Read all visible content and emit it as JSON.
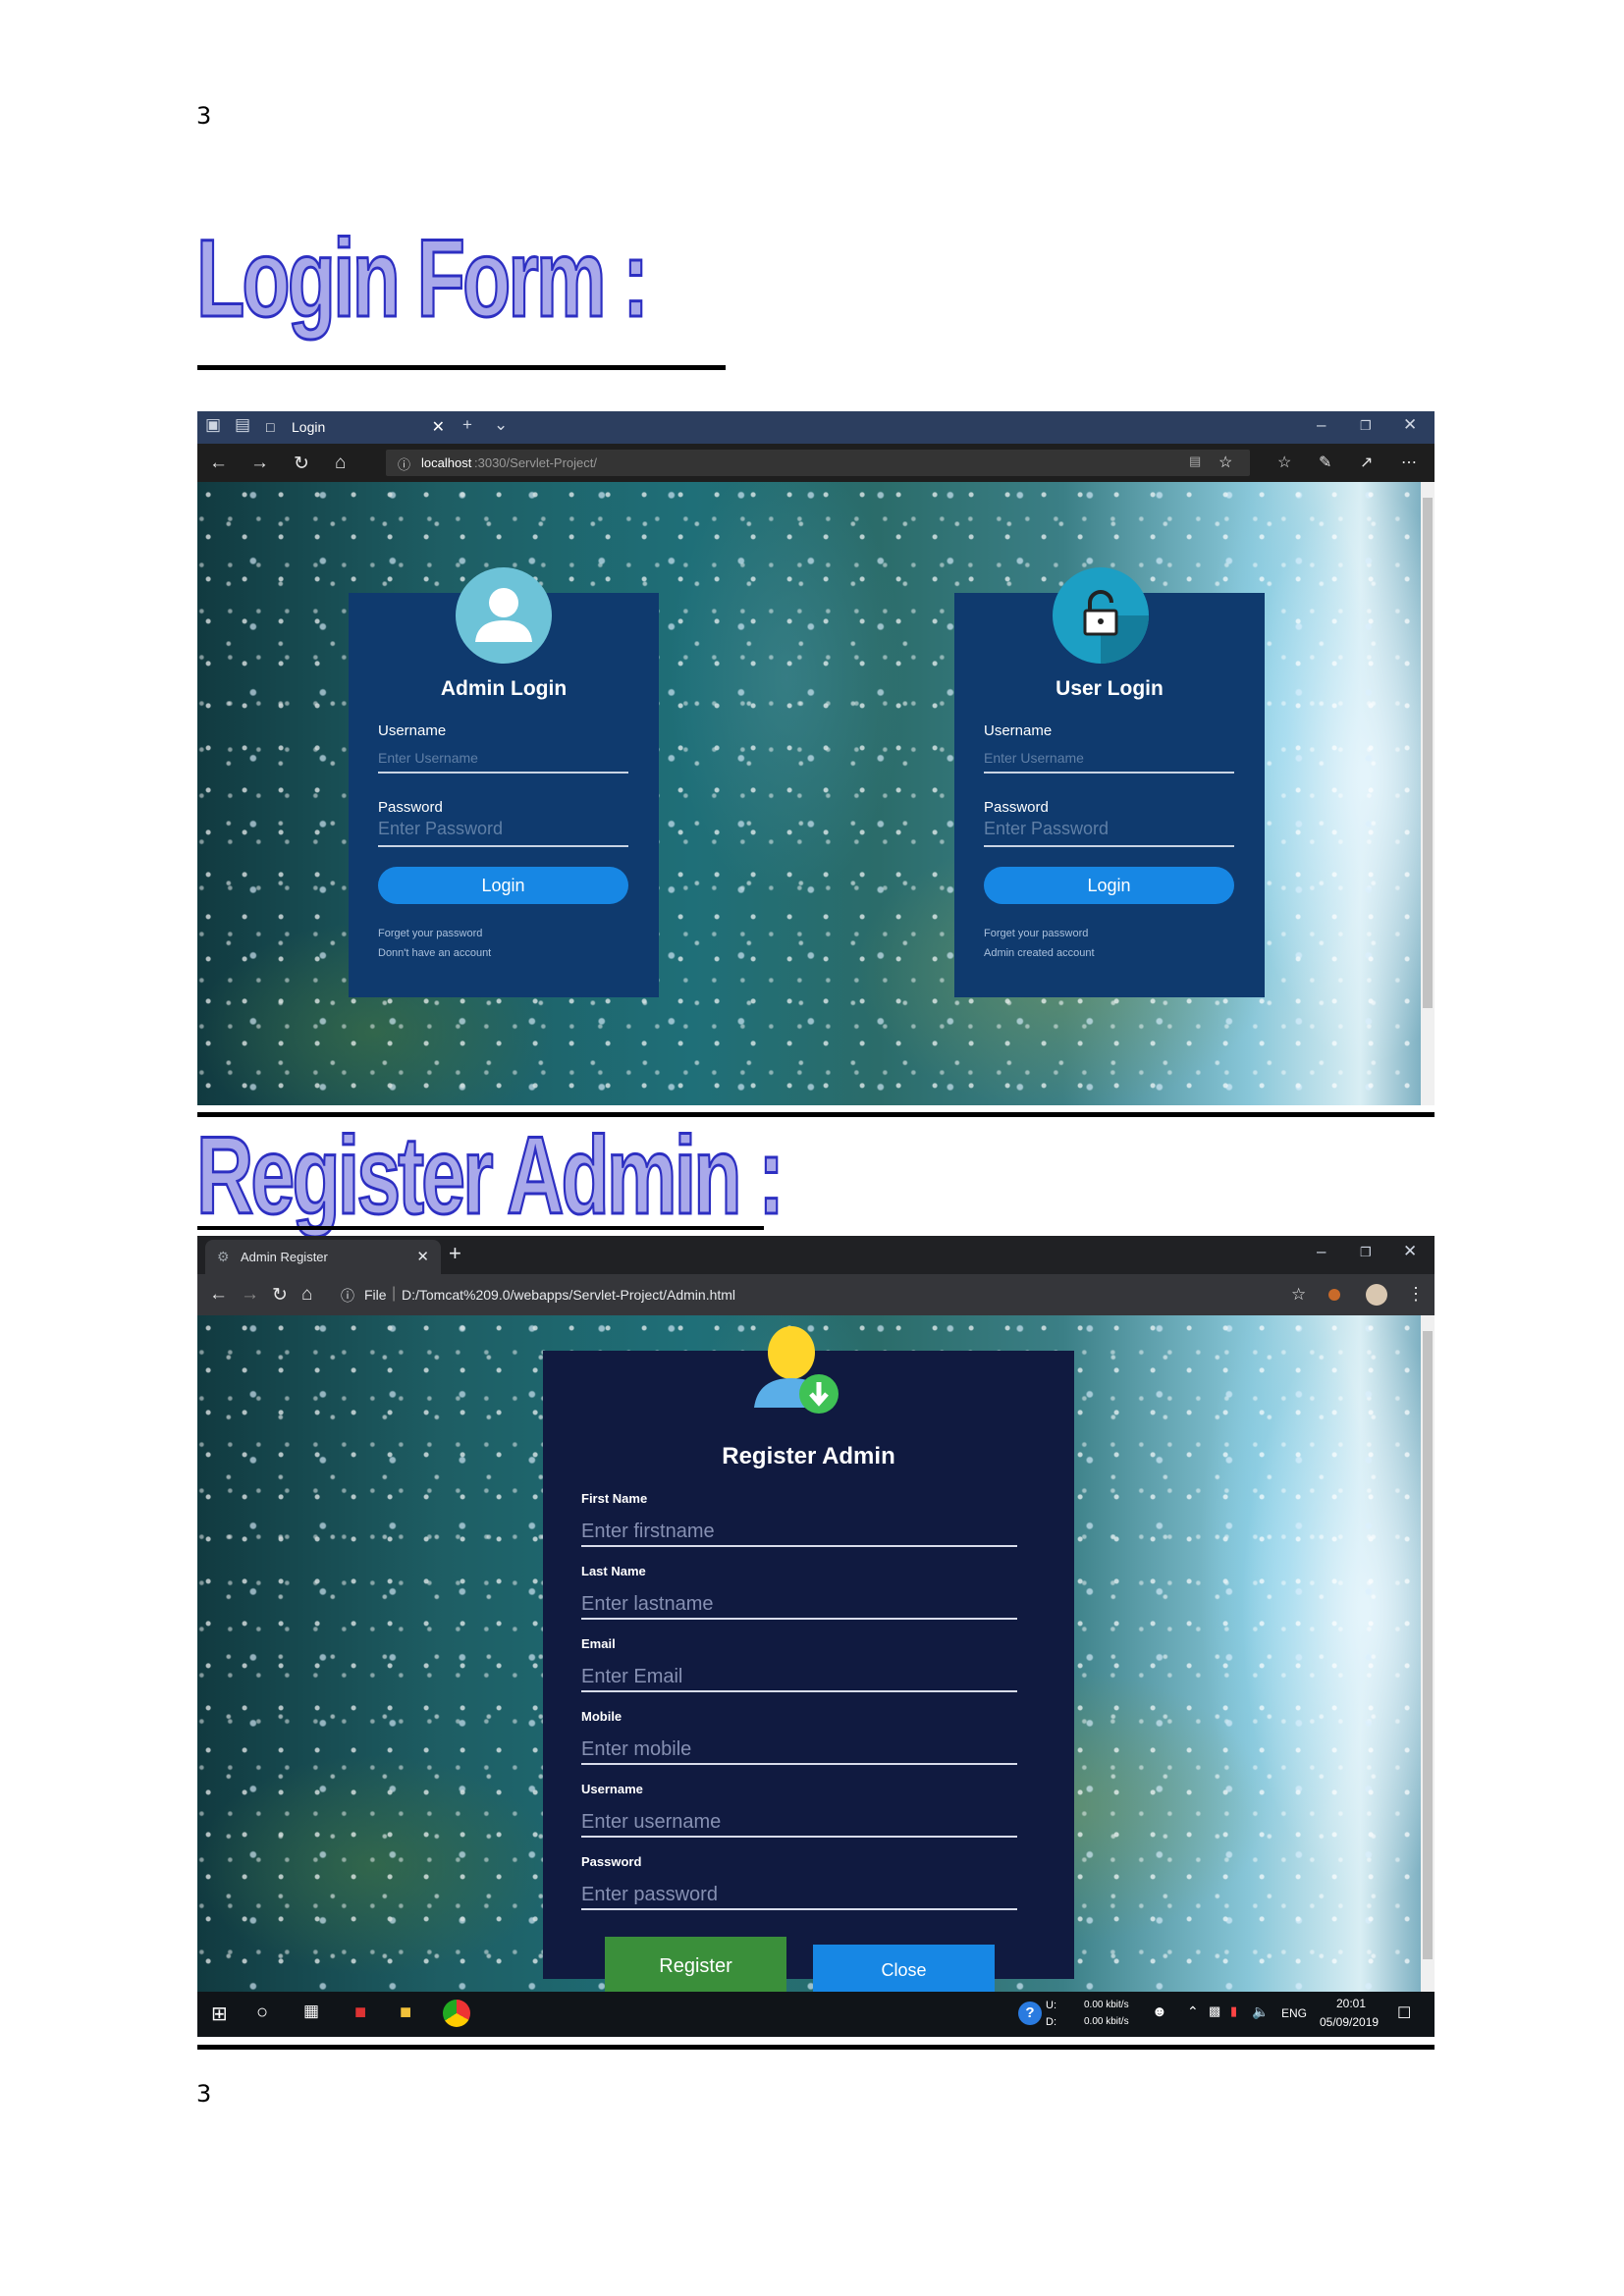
{
  "page_number": "3",
  "heading_login": "Login Form :",
  "heading_register": "Register Admin :",
  "edge": {
    "tab_title": "Login",
    "url_host": "localhost",
    "url_rest": ":3030/Servlet-Project/"
  },
  "admin_login": {
    "title": "Admin Login",
    "username_label": "Username",
    "username_placeholder": "Enter Username",
    "password_label": "Password",
    "password_placeholder": "Enter Password",
    "button": "Login",
    "link1": "Forget your password",
    "link2": "Donn't have an account"
  },
  "user_login": {
    "title": "User Login",
    "username_label": "Username",
    "username_placeholder": "Enter Username",
    "password_label": "Password",
    "password_placeholder": "Enter Password",
    "button": "Login",
    "link1": "Forget your password",
    "link2": "Admin created account"
  },
  "chrome": {
    "tab_title": "Admin Register",
    "file_label": "File",
    "url": "D:/Tomcat%209.0/webapps/Servlet-Project/Admin.html"
  },
  "register": {
    "title": "Register Admin",
    "fields": [
      {
        "label": "First Name",
        "placeholder": "Enter firstname"
      },
      {
        "label": "Last Name",
        "placeholder": "Enter lastname"
      },
      {
        "label": "Email",
        "placeholder": "Enter Email"
      },
      {
        "label": "Mobile",
        "placeholder": "Enter mobile"
      },
      {
        "label": "Username",
        "placeholder": "Enter username"
      },
      {
        "label": "Password",
        "placeholder": "Enter password"
      }
    ],
    "register_button": "Register",
    "close_button": "Close",
    "register_color": "#3a8f3a",
    "close_color": "#1787e4"
  },
  "taskbar": {
    "net_up_label": "U:",
    "net_down_label": "D:",
    "net_up": "0.00 kbit/s",
    "net_down": "0.00 kbit/s",
    "lang": "ENG",
    "time": "20:01",
    "date": "05/09/2019"
  }
}
